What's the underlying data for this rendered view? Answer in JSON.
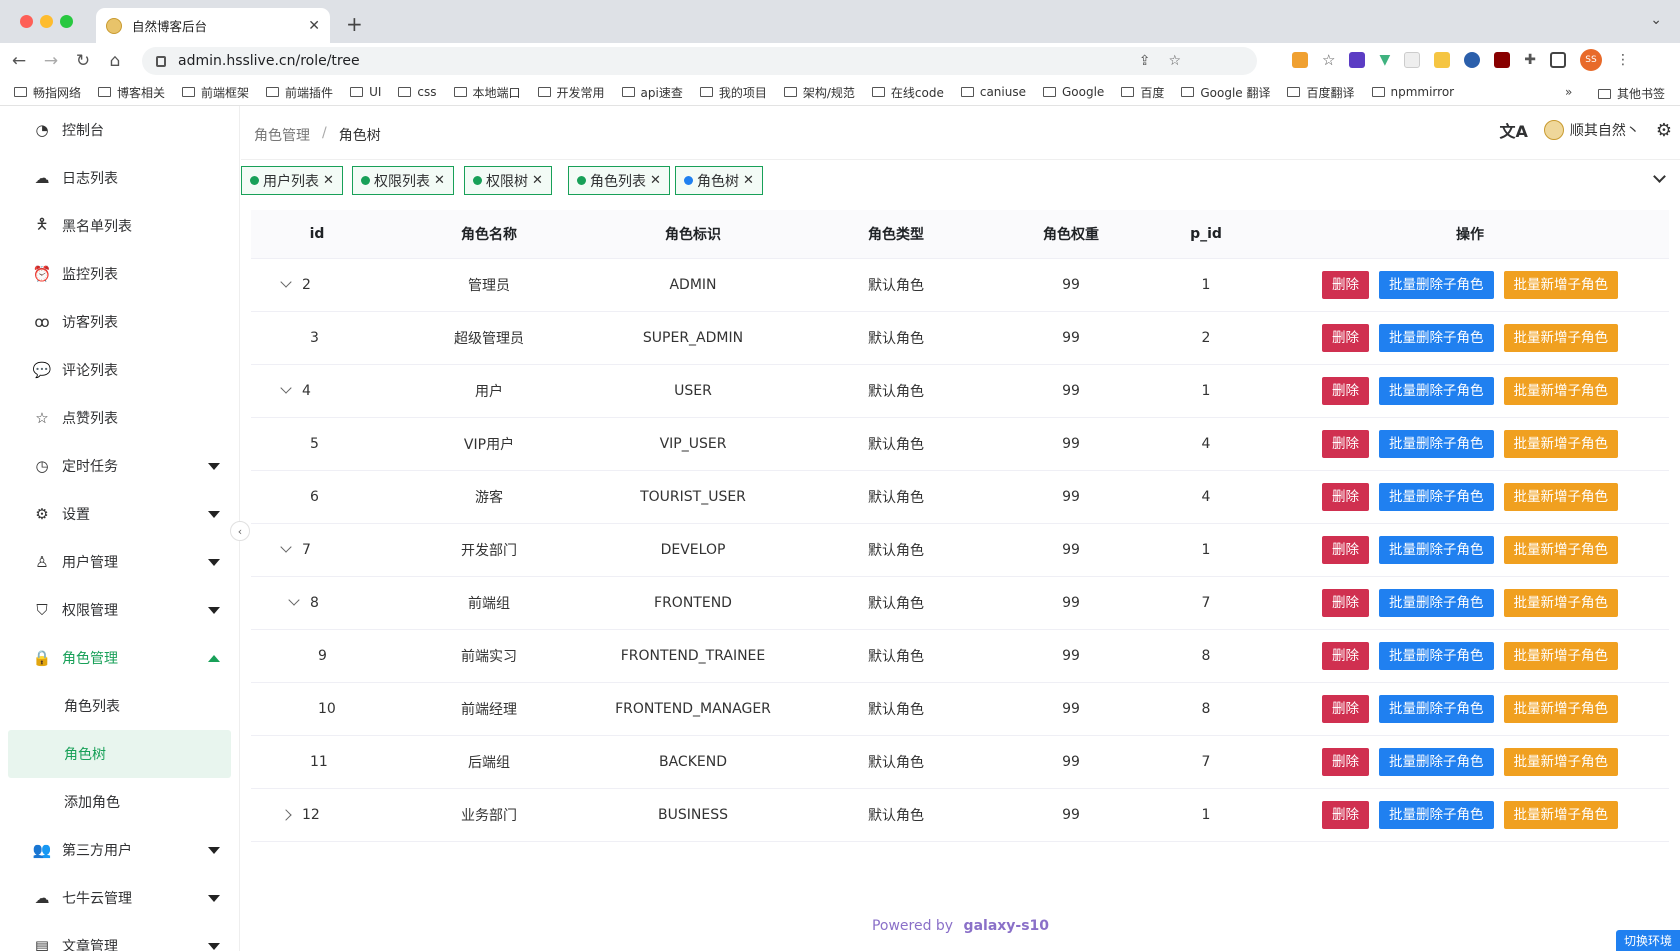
{
  "browser": {
    "tab_title": "自然博客后台",
    "url": "admin.hsslive.cn/role/tree",
    "avatar_initials": "SS",
    "bookmarks": [
      "畅指网络",
      "博客相关",
      "前端框架",
      "前端插件",
      "UI",
      "css",
      "本地端口",
      "开发常用",
      "api速查",
      "我的项目",
      "架构/规范",
      "在线code",
      "caniuse",
      "Google",
      "百度",
      "Google 翻译",
      "百度翻译",
      "npmmirror"
    ],
    "bookmarks_more": "»",
    "other_bookmarks": "其他书签"
  },
  "sidebar": {
    "items": [
      {
        "label": "控制台",
        "icon": "dashboard-icon"
      },
      {
        "label": "日志列表",
        "icon": "cloud-icon"
      },
      {
        "label": "黑名单列表",
        "icon": "person-block-icon"
      },
      {
        "label": "监控列表",
        "icon": "alarm-icon"
      },
      {
        "label": "访客列表",
        "icon": "footprint-icon"
      },
      {
        "label": "评论列表",
        "icon": "comment-icon"
      },
      {
        "label": "点赞列表",
        "icon": "star-icon"
      },
      {
        "label": "定时任务",
        "icon": "clock-icon",
        "expandable": true
      },
      {
        "label": "设置",
        "icon": "gear-icon",
        "expandable": true
      },
      {
        "label": "用户管理",
        "icon": "user-icon",
        "expandable": true
      },
      {
        "label": "权限管理",
        "icon": "shield-icon",
        "expandable": true
      },
      {
        "label": "角色管理",
        "icon": "lock-icon",
        "expandable": true,
        "open": true
      },
      {
        "label": "第三方用户",
        "icon": "users-icon",
        "expandable": true
      },
      {
        "label": "七牛云管理",
        "icon": "cloud-upload-icon",
        "expandable": true
      },
      {
        "label": "文章管理",
        "icon": "article-icon",
        "expandable": true
      }
    ],
    "role_submenu": [
      "角色列表",
      "角色树",
      "添加角色"
    ],
    "active_sub": "角色树"
  },
  "header": {
    "breadcrumb_parent": "角色管理",
    "breadcrumb_sep": "/",
    "breadcrumb_current": "角色树",
    "user_name": "顺其自然丶"
  },
  "tags": [
    {
      "label": "用户列表"
    },
    {
      "label": "权限列表"
    },
    {
      "label": "权限树"
    },
    {
      "label": "角色列表"
    },
    {
      "label": "角色树",
      "active": true
    }
  ],
  "table": {
    "columns": [
      "id",
      "角色名称",
      "角色标识",
      "角色类型",
      "角色权重",
      "p_id",
      "操作"
    ],
    "rows": [
      {
        "id": "2",
        "name": "管理员",
        "key": "ADMIN",
        "type": "默认角色",
        "weight": "99",
        "pid": "1",
        "toggle": "down",
        "indent": 0
      },
      {
        "id": "3",
        "name": "超级管理员",
        "key": "SUPER_ADMIN",
        "type": "默认角色",
        "weight": "99",
        "pid": "2",
        "toggle": "",
        "indent": 1
      },
      {
        "id": "4",
        "name": "用户",
        "key": "USER",
        "type": "默认角色",
        "weight": "99",
        "pid": "1",
        "toggle": "down",
        "indent": 0
      },
      {
        "id": "5",
        "name": "VIP用户",
        "key": "VIP_USER",
        "type": "默认角色",
        "weight": "99",
        "pid": "4",
        "toggle": "",
        "indent": 1
      },
      {
        "id": "6",
        "name": "游客",
        "key": "TOURIST_USER",
        "type": "默认角色",
        "weight": "99",
        "pid": "4",
        "toggle": "",
        "indent": 1
      },
      {
        "id": "7",
        "name": "开发部门",
        "key": "DEVELOP",
        "type": "默认角色",
        "weight": "99",
        "pid": "1",
        "toggle": "down",
        "indent": 0
      },
      {
        "id": "8",
        "name": "前端组",
        "key": "FRONTEND",
        "type": "默认角色",
        "weight": "99",
        "pid": "7",
        "toggle": "down",
        "indent": 1
      },
      {
        "id": "9",
        "name": "前端实习",
        "key": "FRONTEND_TRAINEE",
        "type": "默认角色",
        "weight": "99",
        "pid": "8",
        "toggle": "",
        "indent": 2
      },
      {
        "id": "10",
        "name": "前端经理",
        "key": "FRONTEND_MANAGER",
        "type": "默认角色",
        "weight": "99",
        "pid": "8",
        "toggle": "",
        "indent": 2
      },
      {
        "id": "11",
        "name": "后端组",
        "key": "BACKEND",
        "type": "默认角色",
        "weight": "99",
        "pid": "7",
        "toggle": "",
        "indent": 1
      },
      {
        "id": "12",
        "name": "业务部门",
        "key": "BUSINESS",
        "type": "默认角色",
        "weight": "99",
        "pid": "1",
        "toggle": "right",
        "indent": 0
      }
    ],
    "actions": {
      "delete": "删除",
      "batch_delete": "批量删除子角色",
      "batch_add": "批量新增子角色"
    }
  },
  "footer": {
    "powered": "Powered by",
    "brand": "galaxy-s10"
  },
  "env_badge": "切换环境",
  "colors": {
    "primary": "#18a058",
    "danger": "#d03050",
    "info": "#2080f0",
    "warning": "#f0a020"
  }
}
